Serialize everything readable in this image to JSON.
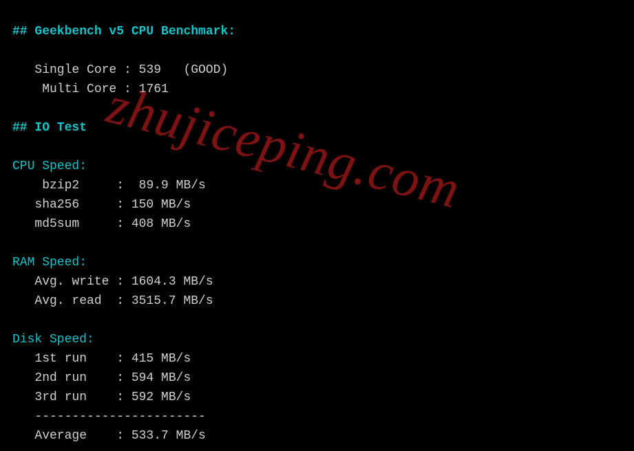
{
  "headings": {
    "geekbench": "## Geekbench v5 CPU Benchmark:",
    "iotest": "## IO Test",
    "cpuspeed": "CPU Speed:",
    "ramspeed": "RAM Speed:",
    "diskspeed": "Disk Speed:"
  },
  "geekbench": {
    "single_label": "   Single Core : ",
    "single_value": "539   (GOOD)",
    "multi_label": "    Multi Core : ",
    "multi_value": "1761"
  },
  "cpu": {
    "bzip2_label": "    bzip2     :  ",
    "bzip2_value": "89.9 MB/s",
    "sha256_label": "   sha256     : ",
    "sha256_value": "150 MB/s",
    "md5sum_label": "   md5sum     : ",
    "md5sum_value": "408 MB/s"
  },
  "ram": {
    "write_label": "   Avg. write : ",
    "write_value": "1604.3 MB/s",
    "read_label": "   Avg. read  : ",
    "read_value": "3515.7 MB/s"
  },
  "disk": {
    "run1_label": "   1st run    : ",
    "run1_value": "415 MB/s",
    "run2_label": "   2nd run    : ",
    "run2_value": "594 MB/s",
    "run3_label": "   3rd run    : ",
    "run3_value": "592 MB/s",
    "sep": "   -----------------------",
    "avg_label": "   Average    : ",
    "avg_value": "533.7 MB/s"
  },
  "watermark": "zhujiceping.com"
}
